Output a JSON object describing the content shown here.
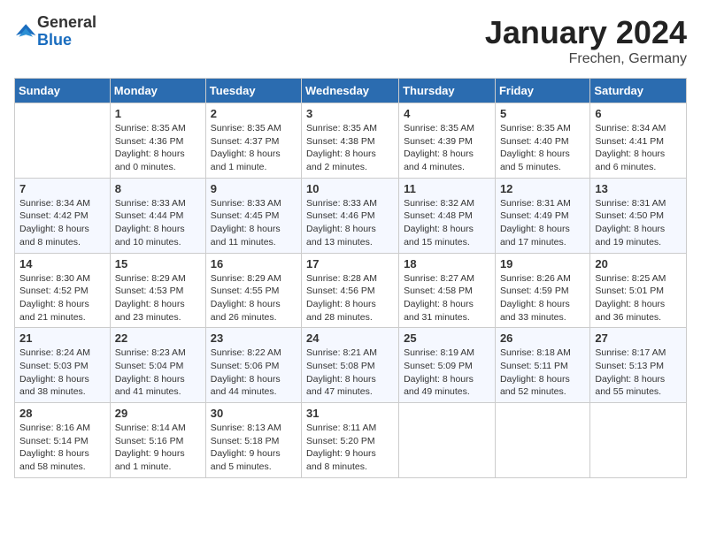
{
  "logo": {
    "general": "General",
    "blue": "Blue"
  },
  "title": "January 2024",
  "location": "Frechen, Germany",
  "days_of_week": [
    "Sunday",
    "Monday",
    "Tuesday",
    "Wednesday",
    "Thursday",
    "Friday",
    "Saturday"
  ],
  "weeks": [
    [
      null,
      {
        "day": 1,
        "sunrise": "8:35 AM",
        "sunset": "4:36 PM",
        "daylight": "8 hours and 0 minutes."
      },
      {
        "day": 2,
        "sunrise": "8:35 AM",
        "sunset": "4:37 PM",
        "daylight": "8 hours and 1 minute."
      },
      {
        "day": 3,
        "sunrise": "8:35 AM",
        "sunset": "4:38 PM",
        "daylight": "8 hours and 2 minutes."
      },
      {
        "day": 4,
        "sunrise": "8:35 AM",
        "sunset": "4:39 PM",
        "daylight": "8 hours and 4 minutes."
      },
      {
        "day": 5,
        "sunrise": "8:35 AM",
        "sunset": "4:40 PM",
        "daylight": "8 hours and 5 minutes."
      },
      {
        "day": 6,
        "sunrise": "8:34 AM",
        "sunset": "4:41 PM",
        "daylight": "8 hours and 6 minutes."
      }
    ],
    [
      {
        "day": 7,
        "sunrise": "8:34 AM",
        "sunset": "4:42 PM",
        "daylight": "8 hours and 8 minutes."
      },
      {
        "day": 8,
        "sunrise": "8:33 AM",
        "sunset": "4:44 PM",
        "daylight": "8 hours and 10 minutes."
      },
      {
        "day": 9,
        "sunrise": "8:33 AM",
        "sunset": "4:45 PM",
        "daylight": "8 hours and 11 minutes."
      },
      {
        "day": 10,
        "sunrise": "8:33 AM",
        "sunset": "4:46 PM",
        "daylight": "8 hours and 13 minutes."
      },
      {
        "day": 11,
        "sunrise": "8:32 AM",
        "sunset": "4:48 PM",
        "daylight": "8 hours and 15 minutes."
      },
      {
        "day": 12,
        "sunrise": "8:31 AM",
        "sunset": "4:49 PM",
        "daylight": "8 hours and 17 minutes."
      },
      {
        "day": 13,
        "sunrise": "8:31 AM",
        "sunset": "4:50 PM",
        "daylight": "8 hours and 19 minutes."
      }
    ],
    [
      {
        "day": 14,
        "sunrise": "8:30 AM",
        "sunset": "4:52 PM",
        "daylight": "8 hours and 21 minutes."
      },
      {
        "day": 15,
        "sunrise": "8:29 AM",
        "sunset": "4:53 PM",
        "daylight": "8 hours and 23 minutes."
      },
      {
        "day": 16,
        "sunrise": "8:29 AM",
        "sunset": "4:55 PM",
        "daylight": "8 hours and 26 minutes."
      },
      {
        "day": 17,
        "sunrise": "8:28 AM",
        "sunset": "4:56 PM",
        "daylight": "8 hours and 28 minutes."
      },
      {
        "day": 18,
        "sunrise": "8:27 AM",
        "sunset": "4:58 PM",
        "daylight": "8 hours and 31 minutes."
      },
      {
        "day": 19,
        "sunrise": "8:26 AM",
        "sunset": "4:59 PM",
        "daylight": "8 hours and 33 minutes."
      },
      {
        "day": 20,
        "sunrise": "8:25 AM",
        "sunset": "5:01 PM",
        "daylight": "8 hours and 36 minutes."
      }
    ],
    [
      {
        "day": 21,
        "sunrise": "8:24 AM",
        "sunset": "5:03 PM",
        "daylight": "8 hours and 38 minutes."
      },
      {
        "day": 22,
        "sunrise": "8:23 AM",
        "sunset": "5:04 PM",
        "daylight": "8 hours and 41 minutes."
      },
      {
        "day": 23,
        "sunrise": "8:22 AM",
        "sunset": "5:06 PM",
        "daylight": "8 hours and 44 minutes."
      },
      {
        "day": 24,
        "sunrise": "8:21 AM",
        "sunset": "5:08 PM",
        "daylight": "8 hours and 47 minutes."
      },
      {
        "day": 25,
        "sunrise": "8:19 AM",
        "sunset": "5:09 PM",
        "daylight": "8 hours and 49 minutes."
      },
      {
        "day": 26,
        "sunrise": "8:18 AM",
        "sunset": "5:11 PM",
        "daylight": "8 hours and 52 minutes."
      },
      {
        "day": 27,
        "sunrise": "8:17 AM",
        "sunset": "5:13 PM",
        "daylight": "8 hours and 55 minutes."
      }
    ],
    [
      {
        "day": 28,
        "sunrise": "8:16 AM",
        "sunset": "5:14 PM",
        "daylight": "8 hours and 58 minutes."
      },
      {
        "day": 29,
        "sunrise": "8:14 AM",
        "sunset": "5:16 PM",
        "daylight": "9 hours and 1 minute."
      },
      {
        "day": 30,
        "sunrise": "8:13 AM",
        "sunset": "5:18 PM",
        "daylight": "9 hours and 5 minutes."
      },
      {
        "day": 31,
        "sunrise": "8:11 AM",
        "sunset": "5:20 PM",
        "daylight": "9 hours and 8 minutes."
      },
      null,
      null,
      null
    ]
  ],
  "labels": {
    "sunrise": "Sunrise:",
    "sunset": "Sunset:",
    "daylight": "Daylight:"
  }
}
